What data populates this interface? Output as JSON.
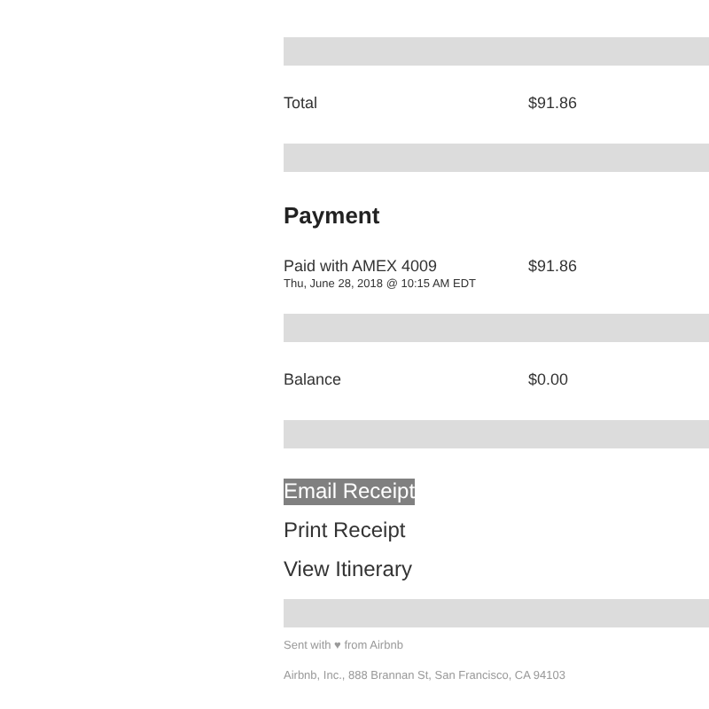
{
  "summary_rows": [
    {
      "label": "Total",
      "amount": "$91.86"
    }
  ],
  "payment": {
    "title": "Payment",
    "label": "Paid with AMEX 4009",
    "date": "Thu, June 28, 2018 @ 10:15 AM EDT",
    "amount": "$91.86"
  },
  "balance": {
    "label": "Balance",
    "amount": "$0.00"
  },
  "links": [
    {
      "label": "Email Receipt",
      "selected": true
    },
    {
      "label": "Print Receipt",
      "selected": false
    },
    {
      "label": "View Itinerary",
      "selected": false
    }
  ],
  "footer": [
    "Sent with ♥ from Airbnb",
    "Airbnb, Inc., 888 Brannan St, San Francisco, CA 94103"
  ]
}
